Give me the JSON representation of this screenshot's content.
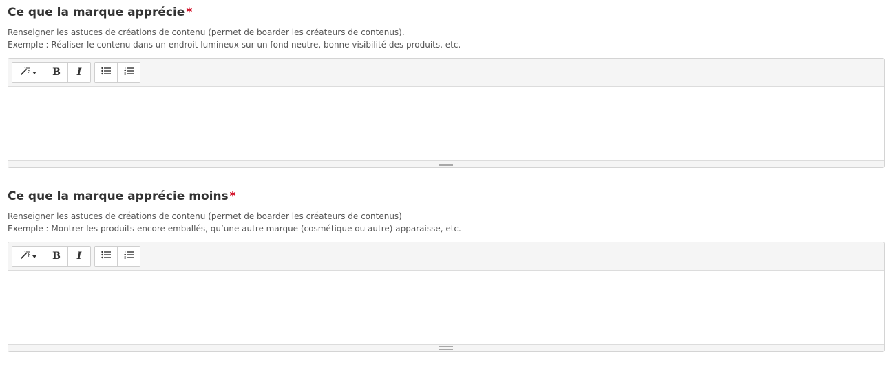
{
  "fields": [
    {
      "title": "Ce que la marque apprécie",
      "required_mark": "*",
      "help_line_1": "Renseigner les astuces de créations de contenu (permet de boarder les créateurs de contenus).",
      "help_line_2": "Exemple : Réaliser le contenu dans un endroit lumineux sur un fond neutre, bonne visibilité des produits, etc.",
      "editor_value": ""
    },
    {
      "title": "Ce que la marque apprécie moins",
      "required_mark": "*",
      "help_line_1": "Renseigner les astuces de créations de contenu (permet de boarder les créateurs de contenus)",
      "help_line_2": "Exemple : Montrer les produits encore emballés, qu’une autre marque (cosmétique ou autre) apparaisse, etc.",
      "editor_value": ""
    }
  ],
  "toolbar": {
    "bold_label": "B",
    "italic_label": "I",
    "icons": [
      "magic-wand-icon",
      "caret-down-icon",
      "unordered-list-icon",
      "ordered-list-icon",
      "resize-grip-icon"
    ]
  },
  "colors": {
    "required": "#d0021b",
    "title": "#333333",
    "help": "#555555",
    "toolbar_bg": "#f5f5f5",
    "border": "#d4d4d4"
  }
}
